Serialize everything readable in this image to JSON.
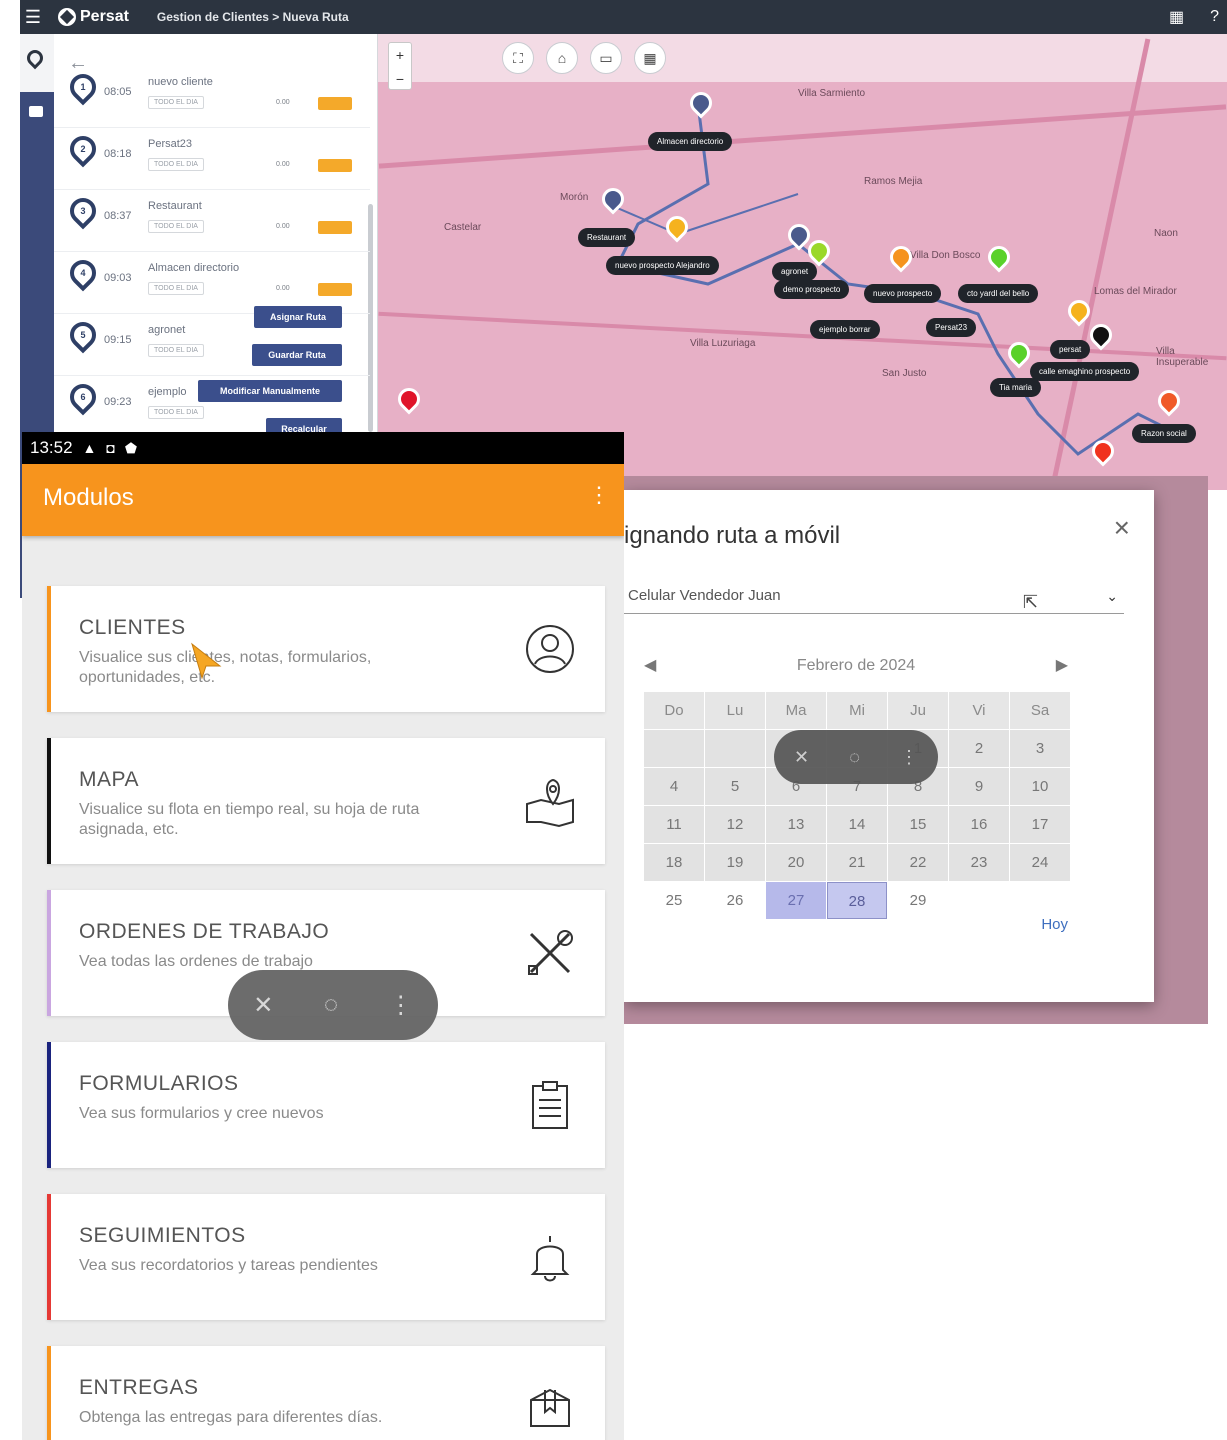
{
  "desktop": {
    "brand": "Persat",
    "breadcrumb": "Gestion de Clientes > Nueva Ruta",
    "stops": [
      {
        "num": "1",
        "time": "08:05",
        "name": "nuevo cliente",
        "tag": "TODO EL DIA",
        "meta": "0.00"
      },
      {
        "num": "2",
        "time": "08:18",
        "name": "Persat23",
        "tag": "TODO EL DIA",
        "meta": "0.00"
      },
      {
        "num": "3",
        "time": "08:37",
        "name": "Restaurant",
        "tag": "TODO EL DIA",
        "meta": "0.00"
      },
      {
        "num": "4",
        "time": "09:03",
        "name": "Almacen directorio",
        "tag": "TODO EL DIA",
        "meta": "0.00"
      },
      {
        "num": "5",
        "time": "09:15",
        "name": "agronet",
        "tag": "TODO EL DIA",
        "meta": "0.00"
      },
      {
        "num": "6",
        "time": "09:23",
        "name": "ejemplo",
        "tag": "TODO EL DIA",
        "meta": "0.00"
      }
    ],
    "buttons": {
      "asignar": "Asignar Ruta",
      "guardar": "Guardar Ruta",
      "modificar": "Modificar Manualmente",
      "recalcular": "Recalcular"
    },
    "map": {
      "zoom_in": "+",
      "zoom_out": "−",
      "labels": [
        "Villa Sarmiento",
        "Ramos Mejia",
        "Castelar",
        "Morón",
        "Villa Luzuriaga",
        "San Justo",
        "Villa Don Bosco",
        "Lomas del Mirador",
        "Villa Insuperable",
        "Naon"
      ],
      "chips": [
        "Almacen directorio",
        "Restaurant",
        "nuevo prospecto Alejandro",
        "agronet",
        "demo prospecto",
        "ejemplo borrar",
        "Persat23",
        "nuevo prospecto",
        "cto yardl del bello",
        "persat",
        "calle emaghino prospecto",
        "Tia maria",
        "Razon social"
      ]
    }
  },
  "dialog": {
    "title": "ignando ruta a móvil",
    "selected_vehicle": "Celular Vendedor Juan",
    "month": "Febrero de 2024",
    "weekdays": [
      "Do",
      "Lu",
      "Ma",
      "Mi",
      "Ju",
      "Vi",
      "Sa"
    ],
    "weeks": [
      [
        "",
        "",
        "",
        "",
        "1",
        "2",
        "3"
      ],
      [
        "4",
        "5",
        "6",
        "7",
        "8",
        "9",
        "10"
      ],
      [
        "11",
        "12",
        "13",
        "14",
        "15",
        "16",
        "17"
      ],
      [
        "18",
        "19",
        "20",
        "21",
        "22",
        "23",
        "24"
      ],
      [
        "25",
        "26",
        "27",
        "28",
        "29",
        "",
        ""
      ]
    ],
    "today_label": "Hoy"
  },
  "phone": {
    "time": "13:52",
    "title": "Modulos",
    "modules": [
      {
        "title": "CLIENTES",
        "desc": "Visualice sus clientes, notas, formularios, oportunidades, etc.",
        "icon": "user-circle-icon",
        "accent": "#f7941d"
      },
      {
        "title": "MAPA",
        "desc": "Visualice su flota en tiempo real, su hoja de ruta asignada, etc.",
        "icon": "map-pin-icon",
        "accent": "#111111"
      },
      {
        "title": "ORDENES DE TRABAJO",
        "desc": "Vea todas las ordenes de trabajo",
        "icon": "tools-icon",
        "accent": "#c9a6e0"
      },
      {
        "title": "FORMULARIOS",
        "desc": "Vea sus formularios y cree nuevos",
        "icon": "clipboard-icon",
        "accent": "#1a237e"
      },
      {
        "title": "SEGUIMIENTOS",
        "desc": "Vea sus recordatorios y tareas pendientes",
        "icon": "bell-icon",
        "accent": "#e53935"
      },
      {
        "title": "ENTREGAS",
        "desc": "Obtenga las entregas para diferentes días.",
        "icon": "package-icon",
        "accent": "#f7941d"
      }
    ]
  }
}
